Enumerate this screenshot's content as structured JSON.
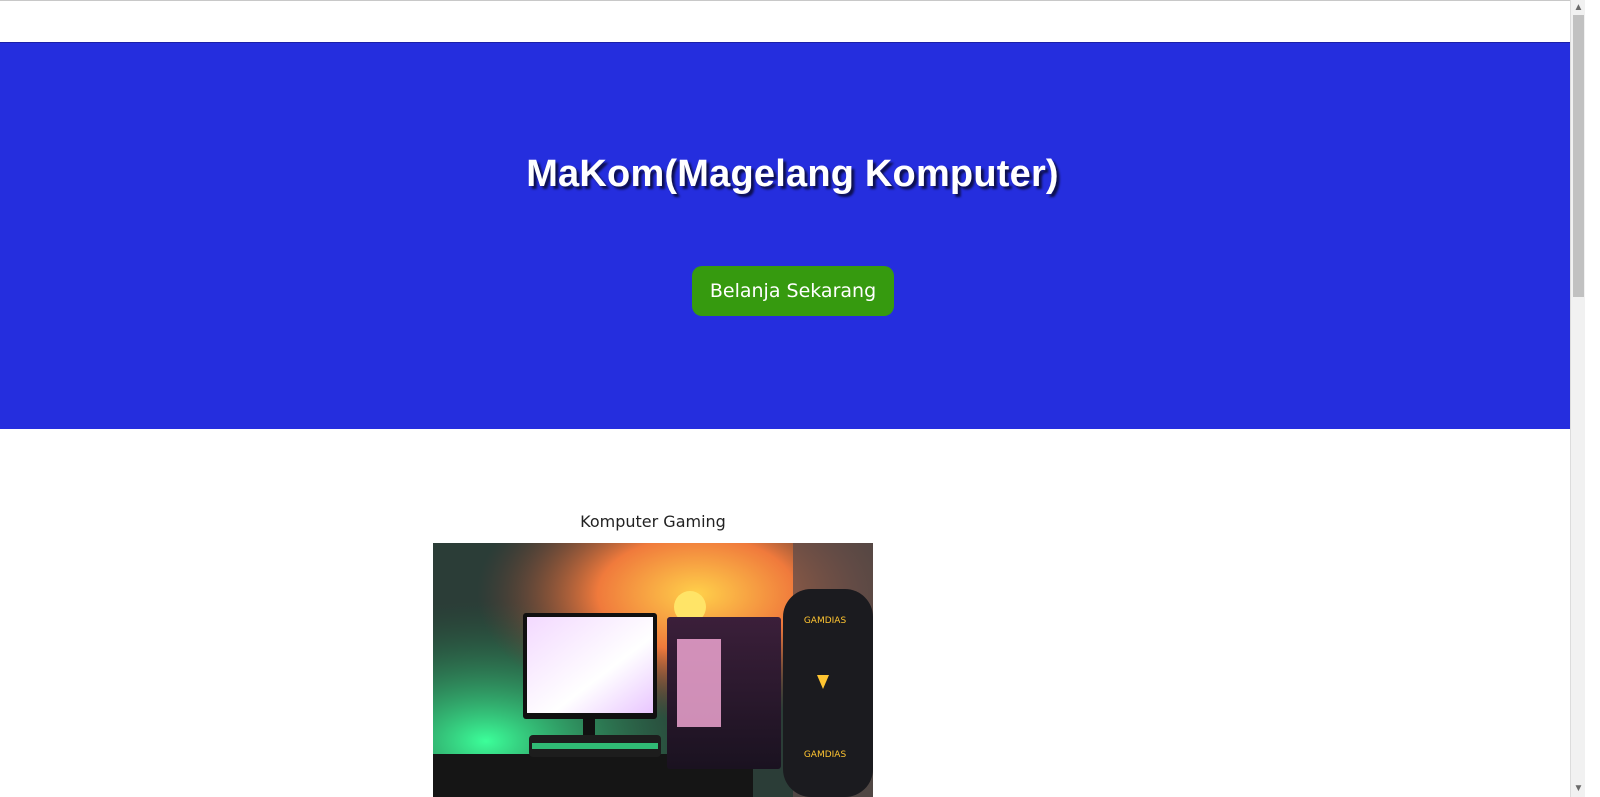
{
  "hero": {
    "title": "MaKom(Magelang Komputer)",
    "cta_label": "Belanja Sekarang",
    "background_color": "#252ede",
    "button_color": "#369a0f"
  },
  "products": [
    {
      "title": "Komputer Gaming",
      "image_alt": "gaming-pc-setup"
    }
  ],
  "image_brand_text": "GAMDIAS"
}
